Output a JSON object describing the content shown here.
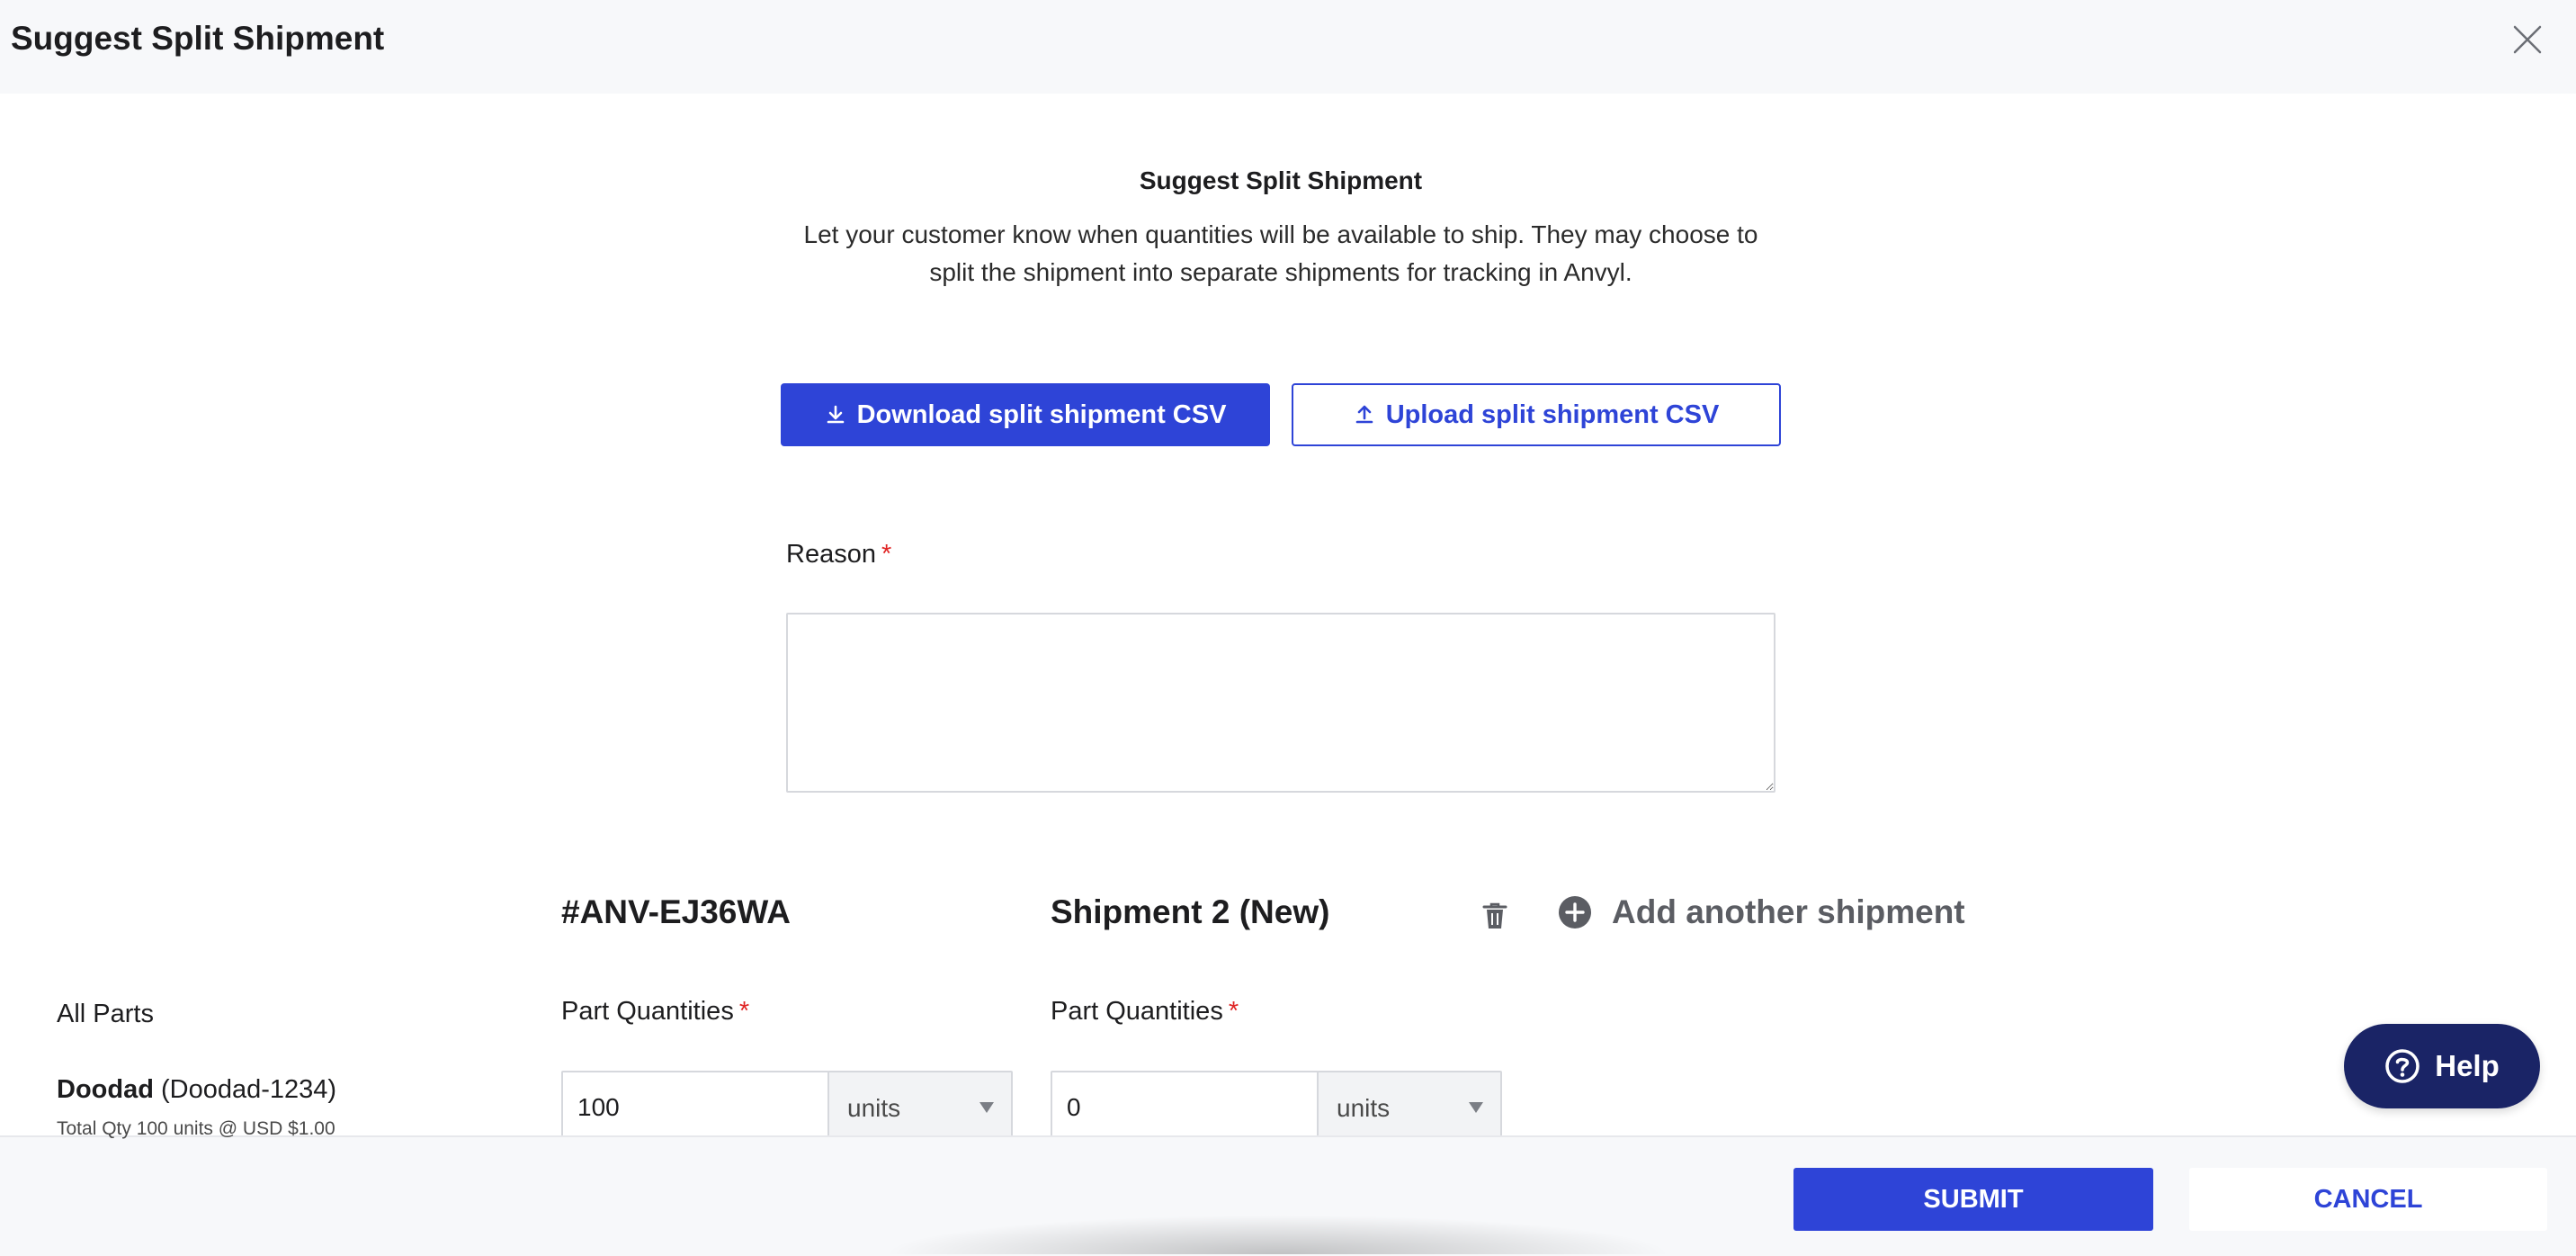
{
  "modal": {
    "title": "Suggest Split Shipment",
    "close_icon": "close-icon"
  },
  "intro": {
    "heading": "Suggest Split Shipment",
    "description": "Let your customer know when quantities will be available to ship. They may choose to split the shipment into separate shipments for tracking in Anvyl."
  },
  "actions": {
    "download_label": "Download split shipment CSV",
    "download_icon": "download-icon",
    "upload_label": "Upload split shipment CSV",
    "upload_icon": "upload-icon"
  },
  "reason": {
    "label": "Reason",
    "required_mark": "*",
    "value": ""
  },
  "shipments": {
    "original_id": "#ANV-EJ36WA",
    "new_title": "Shipment 2 (New)",
    "delete_icon": "trash-icon",
    "add_label": "Add another shipment",
    "add_icon": "plus-circle-icon"
  },
  "parts": {
    "header": "All Parts",
    "quantities_label": "Part Quantities",
    "required_mark": "*",
    "rows": [
      {
        "name": "Doodad",
        "sku": "(Doodad-1234)",
        "meta": "Total Qty 100 units @ USD $1.00",
        "shipment1_qty": "100",
        "shipment1_unit": "units",
        "shipment2_qty": "0",
        "shipment2_unit": "units"
      }
    ]
  },
  "help": {
    "label": "Help",
    "icon": "question-circle-icon"
  },
  "footer": {
    "submit_label": "SUBMIT",
    "cancel_label": "CANCEL"
  },
  "colors": {
    "primary": "#2e44d7",
    "required": "#e02424",
    "help_bg": "#1a2466",
    "header_bg": "#f7f8fa"
  }
}
